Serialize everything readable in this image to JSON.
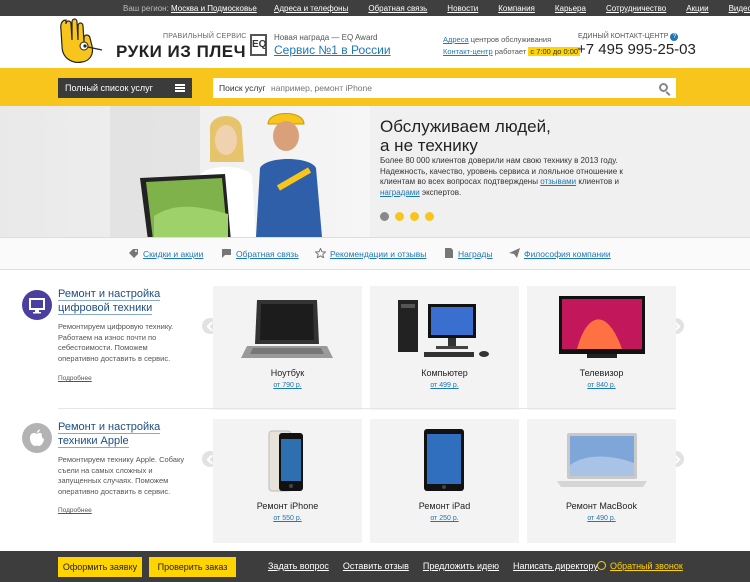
{
  "topbar": {
    "region_label": "Ваш регион:",
    "region_value": "Москва и Подмосковье",
    "links": [
      "Адреса и телефоны",
      "Обратная связь",
      "Новости",
      "Компания",
      "Карьера",
      "Сотрудничество",
      "Акции",
      "Видео"
    ]
  },
  "header": {
    "tagline": "ПРАВИЛЬНЫЙ СЕРВИС",
    "brand": "РУКИ ИЗ ПЛЕЧ",
    "eq_badge": "EQ",
    "award_small": "Новая награда — EQ Award",
    "award_big": "Сервис №1 в России",
    "centers_link": "Адреса",
    "centers_text": "центров обслуживания",
    "contact_link": "Контакт-центр",
    "contact_text": "работает",
    "contact_hours": "с 7:00 до 0:00",
    "hotline_label": "ЕДИНЫЙ КОНТАКТ-ЦЕНТР",
    "hotline_q": "?",
    "phone": "+7 495 995-25-03"
  },
  "nav": {
    "menu_label": "Полный список услуг",
    "search_label": "Поиск услуг",
    "search_placeholder": "например, ремонт iPhone"
  },
  "hero": {
    "title_line1": "Обслуживаем людей,",
    "title_line2": "а не технику",
    "text_part1": "Более 80 000 клиентов доверили нам свою технику в 2013 году. Надежность, качество, уровень сервиса и лояльное отношение к клиентам во всех вопросах подтверждены ",
    "text_link1": "отзывами",
    "text_part2": " клиентов и ",
    "text_link2": "наградами",
    "text_part3": " экспертов.",
    "slides_total": 4,
    "active_slide": 1
  },
  "quick_links": [
    {
      "label": "Скидки и акции",
      "icon": "tag-icon"
    },
    {
      "label": "Обратная связь",
      "icon": "chat-icon"
    },
    {
      "label": "Рекомендации и отзывы",
      "icon": "star-icon"
    },
    {
      "label": "Награды",
      "icon": "document-icon"
    },
    {
      "label": "Философия компании",
      "icon": "paper-plane-icon"
    }
  ],
  "categories": [
    {
      "title_line1": "Ремонт и настройка",
      "title_line2": "цифровой техники",
      "description": "Ремонтируем цифровую технику. Работаем на износ почти по себестоимости. Поможем оперативно доставить в сервис.",
      "more": "Подробнее",
      "icon": "monitor-icon",
      "icon_color": "#4a3f9f",
      "products": [
        {
          "name": "Ноутбук",
          "price": "от 790 р.",
          "icon": "laptop-icon"
        },
        {
          "name": "Компьютер",
          "price": "от 499 р.",
          "icon": "desktop-computer-icon"
        },
        {
          "name": "Телевизор",
          "price": "от 840 р.",
          "icon": "tv-icon"
        }
      ]
    },
    {
      "title_line1": "Ремонт и настройка",
      "title_line2": "техники Apple",
      "description": "Ремонтируем технику Apple. Собаку съели на самых сложных и запущенных случаях. Поможем оперативно доставить в сервис.",
      "more": "Подробнее",
      "icon": "apple-icon",
      "icon_color": "#b3b3b3",
      "products": [
        {
          "name": "Ремонт iPhone",
          "price": "от 550 р.",
          "icon": "iphone-icon"
        },
        {
          "name": "Ремонт iPad",
          "price": "от 250 р.",
          "icon": "ipad-icon"
        },
        {
          "name": "Ремонт MacBook",
          "price": "от 490 р.",
          "icon": "macbook-icon"
        }
      ]
    }
  ],
  "footer": {
    "order_button": "Оформить заявку",
    "check_button": "Проверить заказ",
    "links": [
      "Задать вопрос",
      "Оставить отзыв",
      "Предложить идею",
      "Написать директору"
    ],
    "callback": "Обратный звонок"
  },
  "colors": {
    "accent_yellow": "#f8c51c",
    "link_blue": "#1e77b6",
    "dark": "#3d3d3d"
  }
}
